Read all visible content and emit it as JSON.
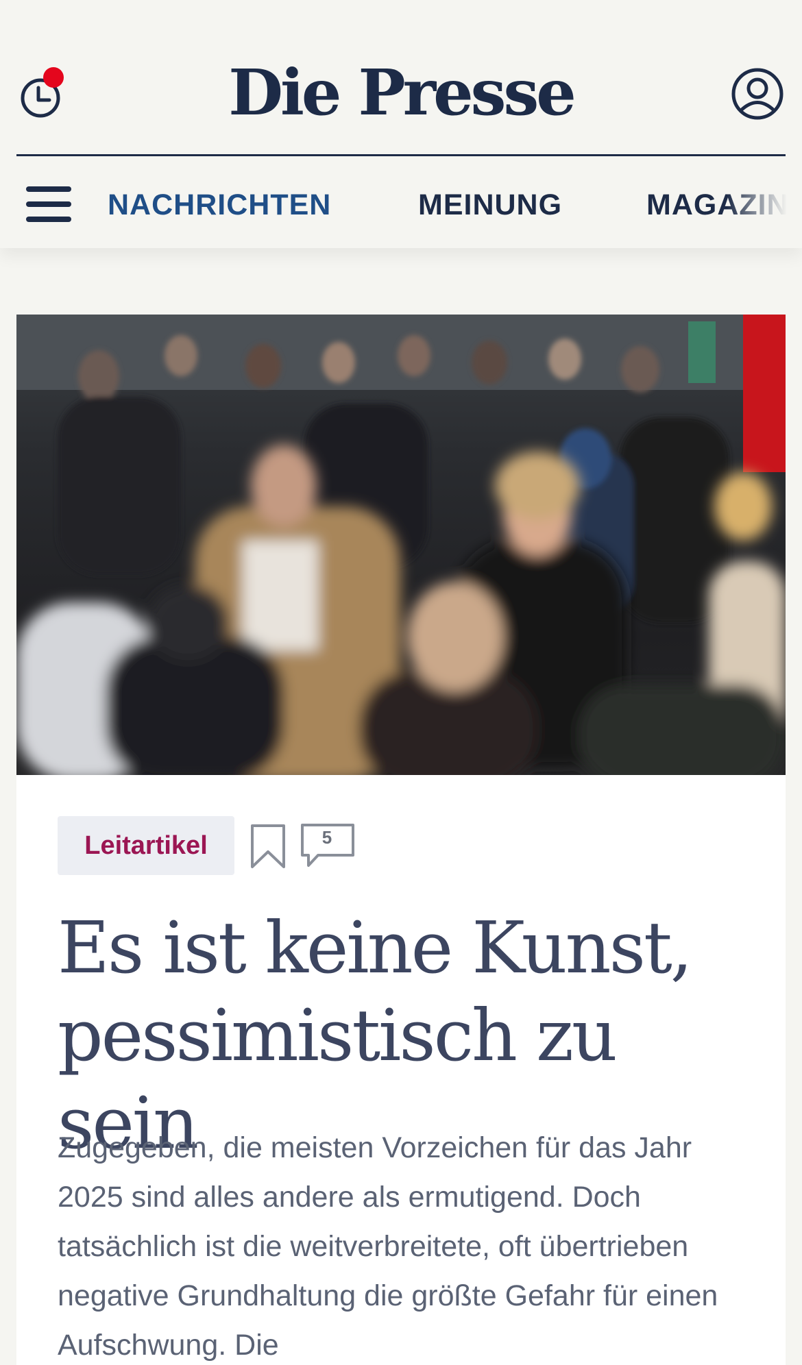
{
  "header": {
    "logo": "Die Presse",
    "history_icon": "clock-icon",
    "notification_icon": "notification-dot-icon",
    "account_icon": "user-icon",
    "accent_color": "#e4061d"
  },
  "nav": {
    "menu_icon": "hamburger-icon",
    "items": [
      {
        "label": "NACHRICHTEN",
        "active": true
      },
      {
        "label": "MEINUNG",
        "active": false
      },
      {
        "label": "MAGAZIN",
        "active": false
      }
    ]
  },
  "article": {
    "tag": "Leitartikel",
    "bookmark_icon": "bookmark-icon",
    "comment_icon": "comment-icon",
    "comment_count": "5",
    "headline": "Es ist keine Kunst, pessimistisch zu sein",
    "lead": "Zugegeben, die meisten Vorzeichen für das Jahr 2025 sind alles andere als ermutigend. Doch tatsächlich ist die weitverbreitete, oft übertrieben negative Grundhaltung die größte Gefahr für einen Aufschwung. Die"
  }
}
